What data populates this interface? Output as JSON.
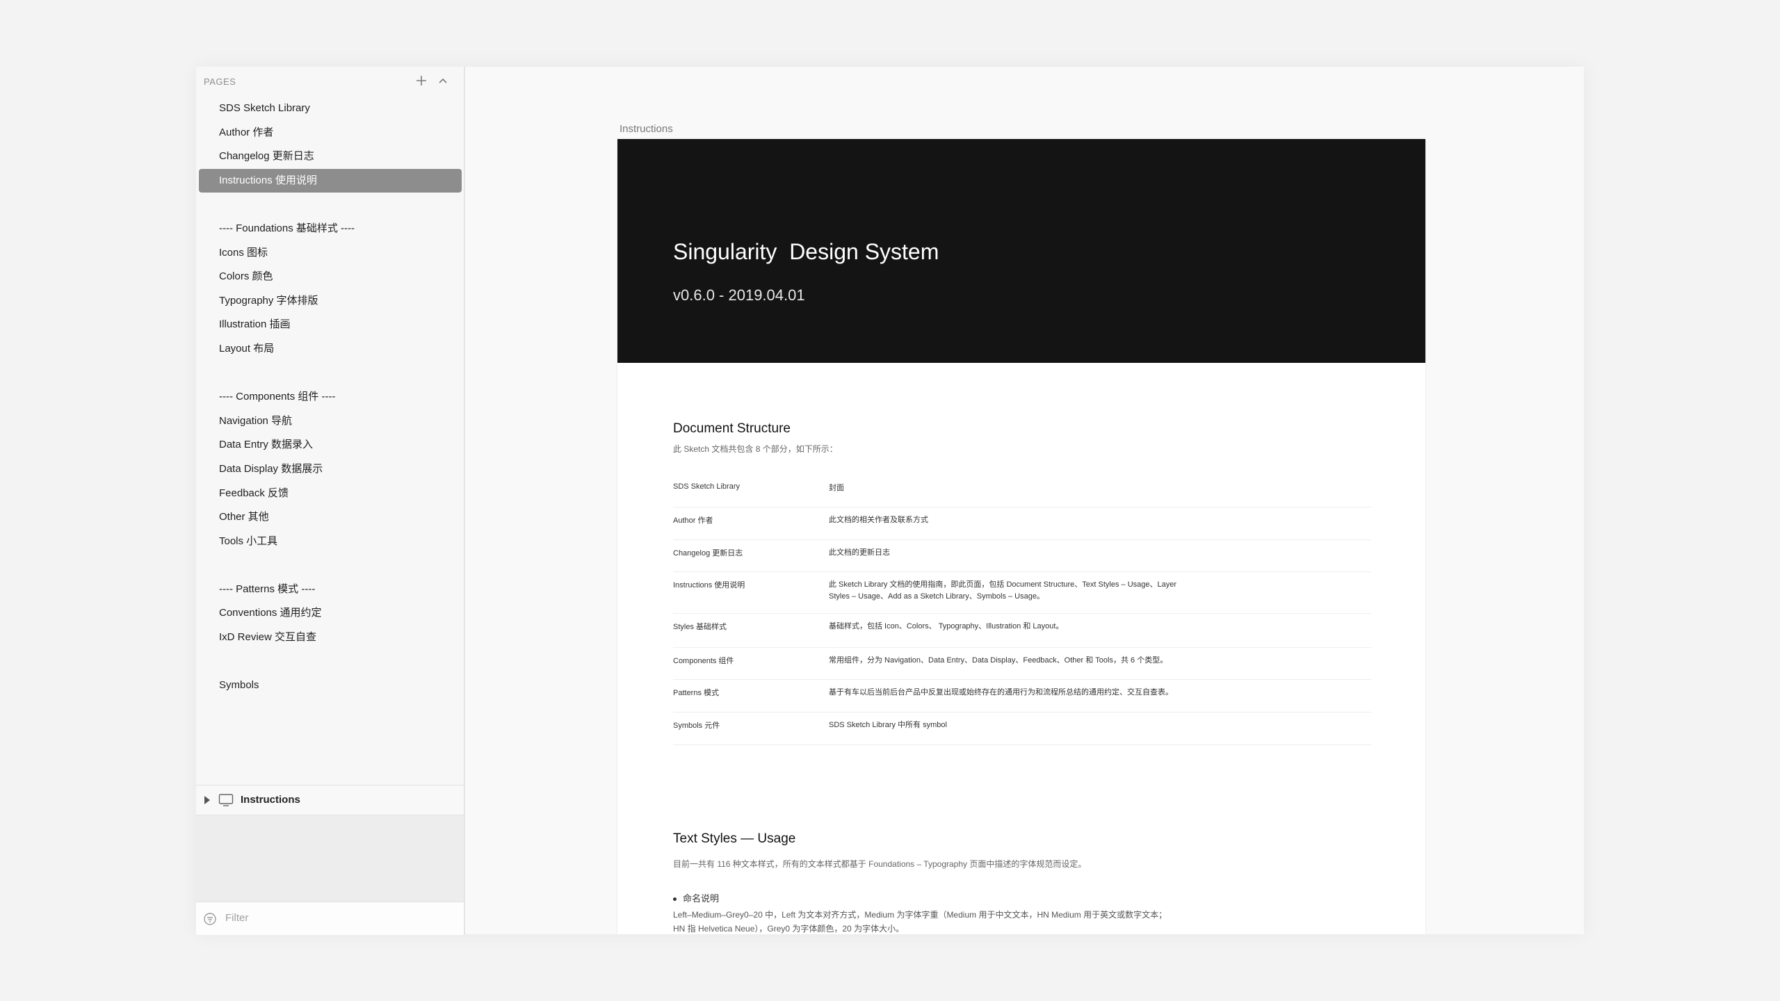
{
  "sidebar": {
    "pages_title": "PAGES",
    "add_icon": "plus-icon",
    "collapse_icon": "chevron-up-icon",
    "pages": [
      {
        "label": "SDS Sketch Library",
        "active": false
      },
      {
        "label": "Author 作者",
        "active": false
      },
      {
        "label": "Changelog 更新日志",
        "active": false
      },
      {
        "label": "Instructions 使用说明",
        "active": true
      },
      {
        "label": "",
        "spacer": true
      },
      {
        "label": "---- Foundations 基础样式 ----",
        "active": false
      },
      {
        "label": "Icons 图标",
        "active": false
      },
      {
        "label": "Colors 颜色",
        "active": false
      },
      {
        "label": "Typography 字体排版",
        "active": false
      },
      {
        "label": "Illustration 插画",
        "active": false
      },
      {
        "label": "Layout 布局",
        "active": false
      },
      {
        "label": "",
        "spacer": true
      },
      {
        "label": "---- Components 组件 ----",
        "active": false
      },
      {
        "label": "Navigation 导航",
        "active": false
      },
      {
        "label": "Data Entry 数据录入",
        "active": false
      },
      {
        "label": "Data Display 数据展示",
        "active": false
      },
      {
        "label": "Feedback 反馈",
        "active": false
      },
      {
        "label": "Other 其他",
        "active": false
      },
      {
        "label": "Tools 小工具",
        "active": false
      },
      {
        "label": "",
        "spacer": true
      },
      {
        "label": "---- Patterns 模式 ----",
        "active": false
      },
      {
        "label": "Conventions 通用约定",
        "active": false
      },
      {
        "label": "IxD Review 交互自查",
        "active": false
      },
      {
        "label": "",
        "spacer": true
      },
      {
        "label": "Symbols",
        "active": false
      }
    ],
    "layer": {
      "label": "Instructions",
      "expand_icon": "disclosure-triangle-icon",
      "type_icon": "artboard-icon"
    },
    "filter": {
      "placeholder": "Filter",
      "icon": "filter-icon"
    }
  },
  "canvas": {
    "artboard_label": "Instructions",
    "hero": {
      "title": "Singularity  Design System",
      "subtitle": "v0.6.0 - 2019.04.01"
    },
    "document_structure": {
      "title": "Document Structure",
      "description": "此 Sketch 文档共包含 8 个部分，如下所示：",
      "rows": [
        {
          "name": "SDS Sketch Library",
          "desc": "封面"
        },
        {
          "name": "Author 作者",
          "desc": "此文档的相关作者及联系方式"
        },
        {
          "name": "Changelog 更新日志",
          "desc": "此文档的更新日志"
        },
        {
          "name": "Instructions 使用说明",
          "desc": "此 Sketch Library 文档的使用指南，即此页面，包括 Document Structure、Text Styles – Usage、Layer Styles – Usage、Add as a Sketch Library、Symbols – Usage。"
        },
        {
          "name": "Styles 基础样式",
          "desc": "基础样式，包括 Icon、Colors、 Typography、Illustration 和 Layout。"
        },
        {
          "name": "Components 组件",
          "desc": "常用组件，分为 Navigation、Data Entry、Data Display、Feedback、Other 和 Tools，共 6 个类型。"
        },
        {
          "name": "Patterns 模式",
          "desc": "基于有车以后当前后台产品中反复出现或始终存在的通用行为和流程所总结的通用约定、交互自查表。"
        },
        {
          "name": "Symbols 元件",
          "desc": "SDS Sketch Library 中所有 symbol"
        }
      ]
    },
    "text_styles": {
      "title": "Text Styles — Usage",
      "description": "目前一共有 116 种文本样式，所有的文本样式都基于 Foundations – Typography 页面中描述的字体规范而设定。",
      "bullet": "命名说明",
      "paragraph": "Left–Medium–Grey0–20 中，Left 为文本对齐方式，Medium 为字体字重（Medium 用于中文文本，HN Medium 用于英文或数字文本；HN 指 Helvetica Neue），Grey0 为字体颜色，20 为字体大小。"
    }
  }
}
